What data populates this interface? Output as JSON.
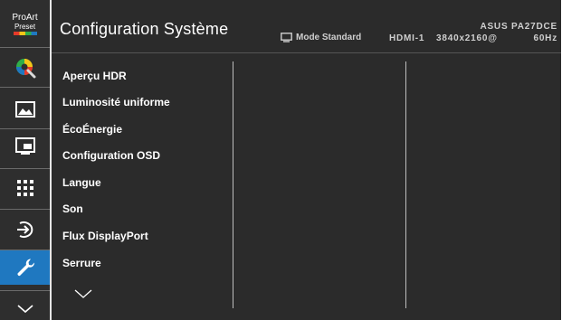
{
  "logo": {
    "line1": "ProArt",
    "line2": "Preset"
  },
  "sidebar": {
    "items": [
      {
        "name": "color-icon",
        "active": false
      },
      {
        "name": "image-icon",
        "active": false
      },
      {
        "name": "pip-icon",
        "active": false
      },
      {
        "name": "qfit-icon",
        "active": false
      },
      {
        "name": "input-select-icon",
        "active": false
      },
      {
        "name": "wrench-icon",
        "active": true
      },
      {
        "name": "chevron-down-icon",
        "active": false
      }
    ],
    "active_color": "#1f78c0"
  },
  "header": {
    "title": "Configuration Système",
    "mode": "Mode Standard",
    "model": "ASUS PA27DCE",
    "input": "HDMI-1",
    "resolution": "3840x2160@",
    "refresh": "60Hz"
  },
  "menu": {
    "items": [
      "Aperçu HDR",
      "Luminosité uniforme",
      "ÉcoÉnergie",
      "Configuration OSD",
      "Langue",
      "Son",
      "Flux DisplayPort",
      "Serrure"
    ]
  }
}
